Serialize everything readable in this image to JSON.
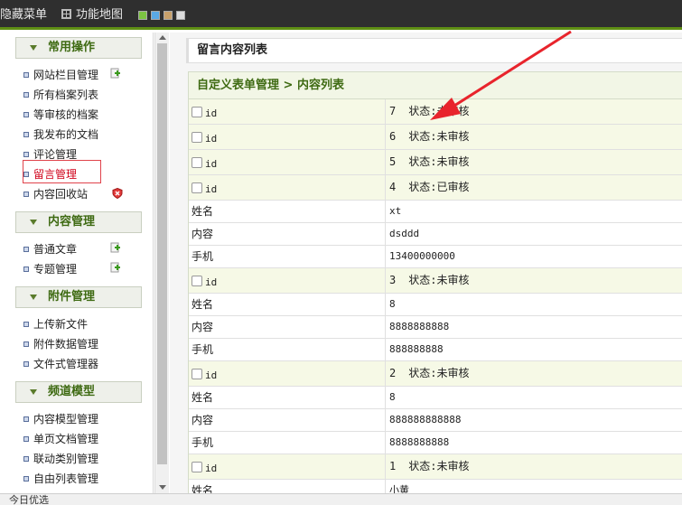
{
  "topbar": {
    "hide_menu_label": "隐藏菜单",
    "site_map_label": "功能地图",
    "theme_colors": [
      "#7cc242",
      "#5aa9e6",
      "#c8a06a",
      "#dcdcdc"
    ]
  },
  "sidebar": {
    "groups": [
      {
        "title": "常用操作",
        "items": [
          "网站栏目管理",
          "所有档案列表",
          "等审核的档案",
          "我发布的文档",
          "评论管理",
          "留言管理",
          "内容回收站"
        ]
      },
      {
        "title": "内容管理",
        "items": [
          "普通文章",
          "专题管理"
        ]
      },
      {
        "title": "附件管理",
        "items": [
          "上传新文件",
          "附件数据管理",
          "文件式管理器"
        ]
      },
      {
        "title": "频道模型",
        "items": [
          "内容模型管理",
          "单页文档管理",
          "联动类别管理",
          "自由列表管理"
        ]
      }
    ],
    "active_item": "留言管理"
  },
  "main": {
    "title": "留言内容列表",
    "breadcrumb": "自定义表单管理 > 内容列表",
    "id_label": "id",
    "status_prefix": "状态:",
    "field_labels": {
      "name": "姓名",
      "content": "内容",
      "phone": "手机"
    },
    "records": [
      {
        "id": "7",
        "status": "未审核",
        "fields": []
      },
      {
        "id": "6",
        "status": "未审核",
        "fields": []
      },
      {
        "id": "5",
        "status": "未审核",
        "fields": []
      },
      {
        "id": "4",
        "status": "已审核",
        "fields": [
          {
            "label": "姓名",
            "value": "xt"
          },
          {
            "label": "内容",
            "value": "dsddd"
          },
          {
            "label": "手机",
            "value": "13400000000"
          }
        ]
      },
      {
        "id": "3",
        "status": "未审核",
        "fields": [
          {
            "label": "姓名",
            "value": "8"
          },
          {
            "label": "内容",
            "value": "8888888888"
          },
          {
            "label": "手机",
            "value": "888888888"
          }
        ]
      },
      {
        "id": "2",
        "status": "未审核",
        "fields": [
          {
            "label": "姓名",
            "value": "8"
          },
          {
            "label": "内容",
            "value": "888888888888"
          },
          {
            "label": "手机",
            "value": "8888888888"
          }
        ]
      },
      {
        "id": "1",
        "status": "未审核",
        "fields": [
          {
            "label": "姓名",
            "value": "小黄"
          }
        ]
      }
    ]
  },
  "bottombar": {
    "text": "今日优选"
  },
  "annotation": {
    "color": "#e8242c"
  }
}
